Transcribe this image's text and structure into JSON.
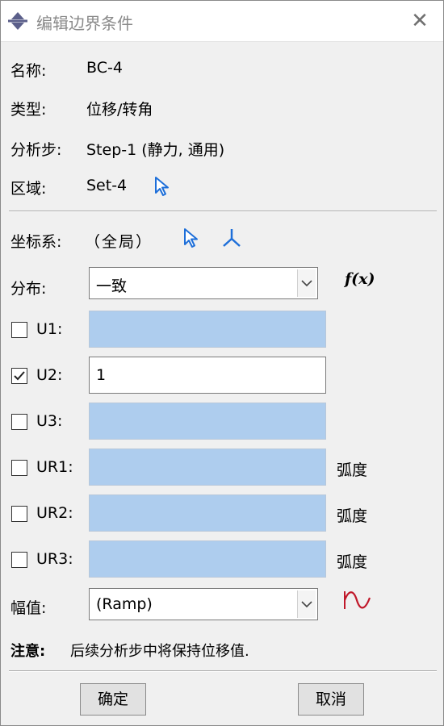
{
  "window": {
    "title": "编辑边界条件",
    "close_glyph": "✕"
  },
  "info": {
    "name_label": "名称:",
    "name_value": "BC-4",
    "type_label": "类型:",
    "type_value": "位移/转角",
    "step_label": "分析步:",
    "step_value": "Step-1 (静力, 通用)",
    "region_label": "区域:",
    "region_value": "Set-4"
  },
  "csys": {
    "label": "坐标系:",
    "value": "（全局）"
  },
  "distribution": {
    "label": "分布:",
    "selected": "一致",
    "fx_label": "f(x)"
  },
  "dofs": [
    {
      "label": "U1:",
      "checked": false,
      "value": "",
      "unit": ""
    },
    {
      "label": "U2:",
      "checked": true,
      "value": "1",
      "unit": ""
    },
    {
      "label": "U3:",
      "checked": false,
      "value": "",
      "unit": ""
    },
    {
      "label": "UR1:",
      "checked": false,
      "value": "",
      "unit": "弧度"
    },
    {
      "label": "UR2:",
      "checked": false,
      "value": "",
      "unit": "弧度"
    },
    {
      "label": "UR3:",
      "checked": false,
      "value": "",
      "unit": "弧度"
    }
  ],
  "amplitude": {
    "label": "幅值:",
    "selected": "(Ramp)"
  },
  "note": {
    "label": "注意:",
    "text": "后续分析步中将保持位移值."
  },
  "buttons": {
    "ok": "确定",
    "cancel": "取消"
  },
  "colors": {
    "disabled_field": "#aecdee",
    "icon_blue": "#1e6fd9",
    "amp_icon_red": "#c0182a"
  }
}
